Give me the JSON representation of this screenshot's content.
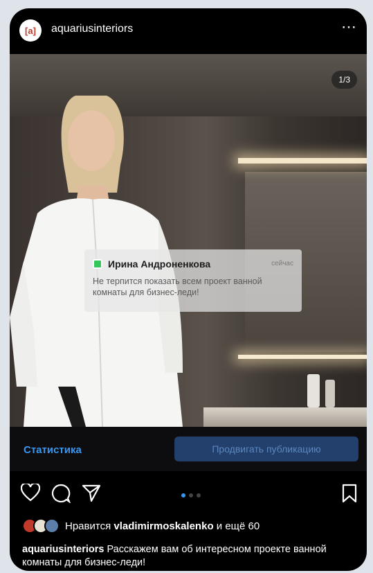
{
  "post": {
    "username": "aquariusinteriors",
    "avatar_text": "[a]",
    "more_icon": "⋯",
    "counter": "1/3"
  },
  "notification": {
    "name": "Ирина Андроненкова",
    "time": "сейчас",
    "text": "Не терпится показать всем проект ванной комнаты для бизнес-леди!",
    "chip_color": "#34c759"
  },
  "bar": {
    "statistics": "Статистика",
    "promote": "Продвигать публикацию"
  },
  "actions": {
    "icons": [
      "heart-icon",
      "comment-icon",
      "share-icon",
      "bookmark-icon"
    ],
    "carousel_dots": 3,
    "active_dot": 0
  },
  "likes": {
    "prefix": "Нравится",
    "user": "vladimirmoskalenko",
    "suffix": "и ещё 60"
  },
  "caption": {
    "user": "aquariusinteriors",
    "text": "Расскажем вам об интересном проекте ванной комнаты для бизнес-леди!"
  },
  "colors": {
    "accent": "#3897f0",
    "promote_bg": "#22406b",
    "background": "#000000"
  }
}
